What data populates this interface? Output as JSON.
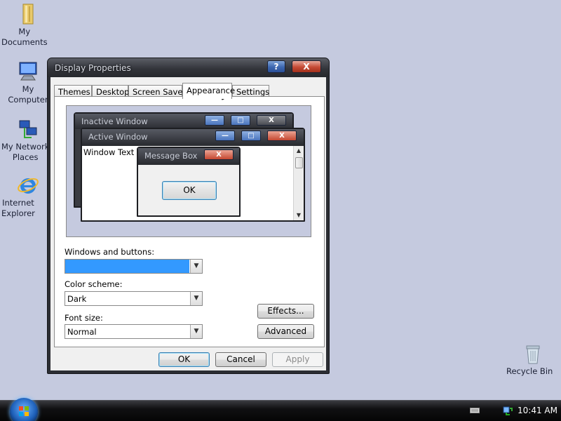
{
  "desktop": {
    "icons": [
      {
        "name": "my-documents",
        "label": "My\nDocuments"
      },
      {
        "name": "my-computer",
        "label": "My Computer"
      },
      {
        "name": "my-network-places",
        "label": "My Network\nPlaces"
      },
      {
        "name": "internet-explorer",
        "label": "Internet\nExplorer"
      },
      {
        "name": "recycle-bin",
        "label": "Recycle Bin"
      }
    ]
  },
  "window": {
    "title": "Display Properties",
    "help_label": "?",
    "close_label": "X",
    "tabs": [
      "Themes",
      "Desktop",
      "Screen Saver",
      "Appearance",
      "Settings"
    ],
    "active_tab": "Appearance",
    "preview": {
      "inactive_title": "Inactive Window",
      "active_title": "Active Window",
      "window_text": "Window Text",
      "message_title": "Message Box",
      "ok_label": "OK",
      "min_glyph": "—",
      "max_glyph": "□",
      "close_glyph": "X"
    },
    "windows_buttons": {
      "label": "Windows and buttons:",
      "value": ""
    },
    "color_scheme": {
      "label": "Color scheme:",
      "value": "Dark"
    },
    "font_size": {
      "label": "Font size:",
      "value": "Normal"
    },
    "effects_label": "Effects...",
    "advanced_label": "Advanced",
    "ok_label": "OK",
    "cancel_label": "Cancel",
    "apply_label": "Apply"
  },
  "taskbar": {
    "clock": "10:41 AM"
  }
}
